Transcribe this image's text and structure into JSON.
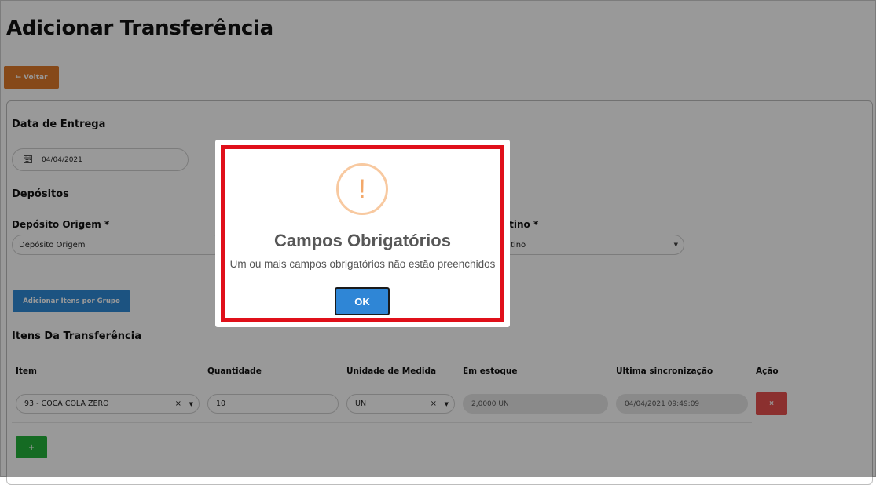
{
  "page": {
    "title": "Adicionar Transferência"
  },
  "toolbar": {
    "back_label": "Voltar"
  },
  "delivery": {
    "section_title": "Data de Entrega",
    "date_value": "04/04/2021"
  },
  "deposits": {
    "section_title": "Depósitos",
    "origin_label": "Depósito Origem *",
    "origin_value": "Depósito Origem",
    "dest_label_visible": "stino *",
    "dest_value_visible": "tino"
  },
  "group_button": {
    "label": "Adicionar Itens por Grupo"
  },
  "items": {
    "section_title": "Itens Da Transferência",
    "columns": [
      "Item",
      "Quantidade",
      "Unidade de Medida",
      "Em estoque",
      "Ultima sincronização",
      "Ação"
    ],
    "rows": [
      {
        "item": "93 - COCA COLA ZERO",
        "quantity": "10",
        "unit": "UN",
        "stock": "2,0000 UN",
        "last_sync": "04/04/2021 09:49:09"
      }
    ],
    "add_label": "+",
    "delete_label": "×"
  },
  "modal": {
    "icon": "!",
    "title": "Campos Obrigatórios",
    "text": "Um ou mais campos obrigatórios não estão preenchidos",
    "ok_label": "OK"
  },
  "colors": {
    "back_button": "#e07a2a",
    "primary": "#2f86d6",
    "danger": "#e8504f",
    "success": "#23b33b",
    "highlight_frame": "#e0101a"
  }
}
